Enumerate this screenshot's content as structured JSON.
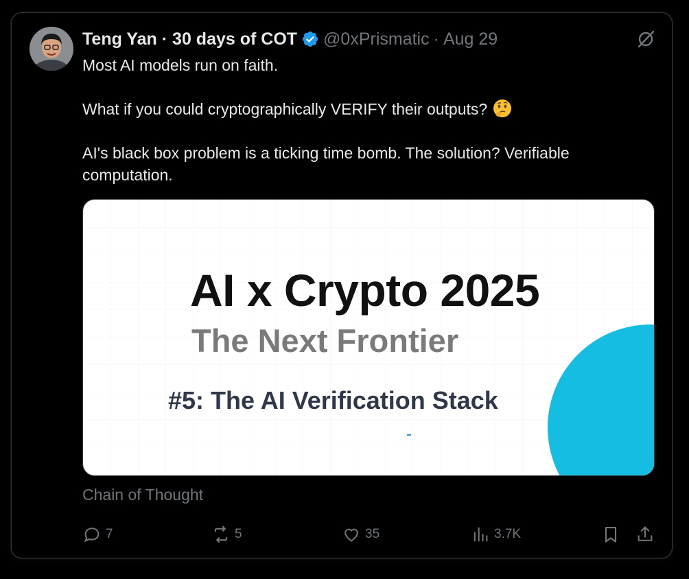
{
  "post": {
    "author": {
      "display_name": "Teng Yan · 30 days of COT",
      "handle": "@0xPrismatic",
      "separator": "·",
      "date": "Aug 29",
      "verified_color": "#1d9bf0"
    },
    "text": {
      "line1": "Most AI models run on faith.",
      "line2": "What if you could cryptographically VERIFY their outputs?",
      "line3": "AI's black box problem is a ticking time bomb. The solution? Verifiable computation."
    },
    "emoji": "thinking-face",
    "media": {
      "title": "AI x Crypto 2025",
      "subtitle": "The Next Frontier",
      "caption": "#5: The AI Verification Stack",
      "accent_color": "#16bde3"
    },
    "source": "Chain of Thought",
    "actions": {
      "replies": "7",
      "reposts": "5",
      "likes": "35",
      "views": "3.7K"
    }
  },
  "icons": [
    "verified-badge-icon",
    "grok-icon",
    "reply-icon",
    "repost-icon",
    "like-icon",
    "views-icon",
    "bookmark-icon",
    "share-icon"
  ]
}
